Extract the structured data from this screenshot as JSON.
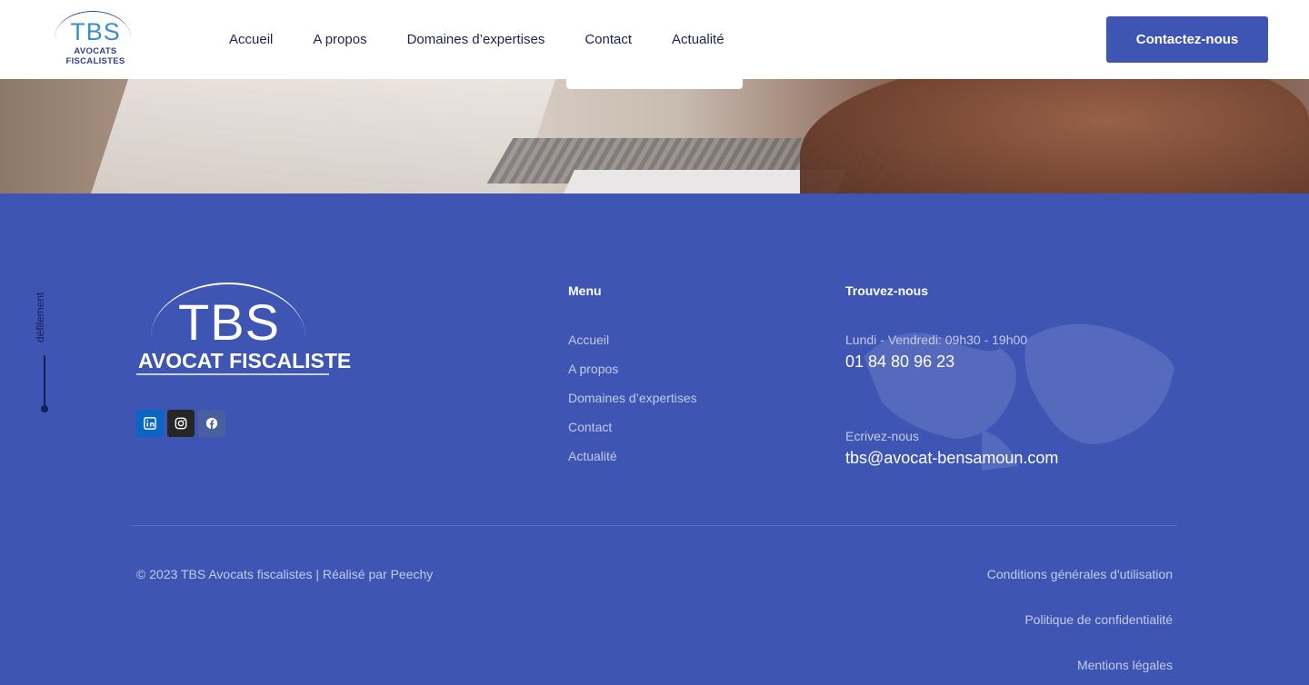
{
  "header": {
    "logo": {
      "brand": "TBS",
      "subtitle": "AVOCATS FISCALISTES"
    },
    "nav": [
      "Accueil",
      "A propos",
      "Domaines d’expertises",
      "Contact",
      "Actualité"
    ],
    "cta_label": "Contactez-nous"
  },
  "scroll": {
    "label": "défilement"
  },
  "footer": {
    "logo": {
      "brand": "TBS",
      "subtitle": "AVOCAT FISCALISTE"
    },
    "socials": [
      {
        "icon": "linkedin-icon",
        "color": "#0a66c2"
      },
      {
        "icon": "instagram-icon",
        "color": "#262626"
      },
      {
        "icon": "facebook-icon",
        "color": "#4a5f9e"
      }
    ],
    "menu": {
      "title": "Menu",
      "items": [
        "Accueil",
        "A propos",
        "Domaines d’expertises",
        "Contact",
        "Actualité"
      ]
    },
    "find": {
      "title": "Trouvez-nous",
      "hours_label": "Lundi - Vendredi: 09h30 - 19h00",
      "phone": "01 84 80 96 23",
      "email_label": "Ecrivez-nous",
      "email": "tbs@avocat-bensamoun.com"
    },
    "copyright": "© 2023 TBS Avocats fiscalistes | Réalisé par Peechy",
    "legal": [
      "Conditions générales d'utilisation",
      "Politique de confidentialité",
      "Mentions légales"
    ]
  },
  "colors": {
    "brand": "#3e55b4",
    "header_bg": "#ffffff",
    "nav_text": "#1c2350",
    "muted_text": "#c4cbe8"
  }
}
